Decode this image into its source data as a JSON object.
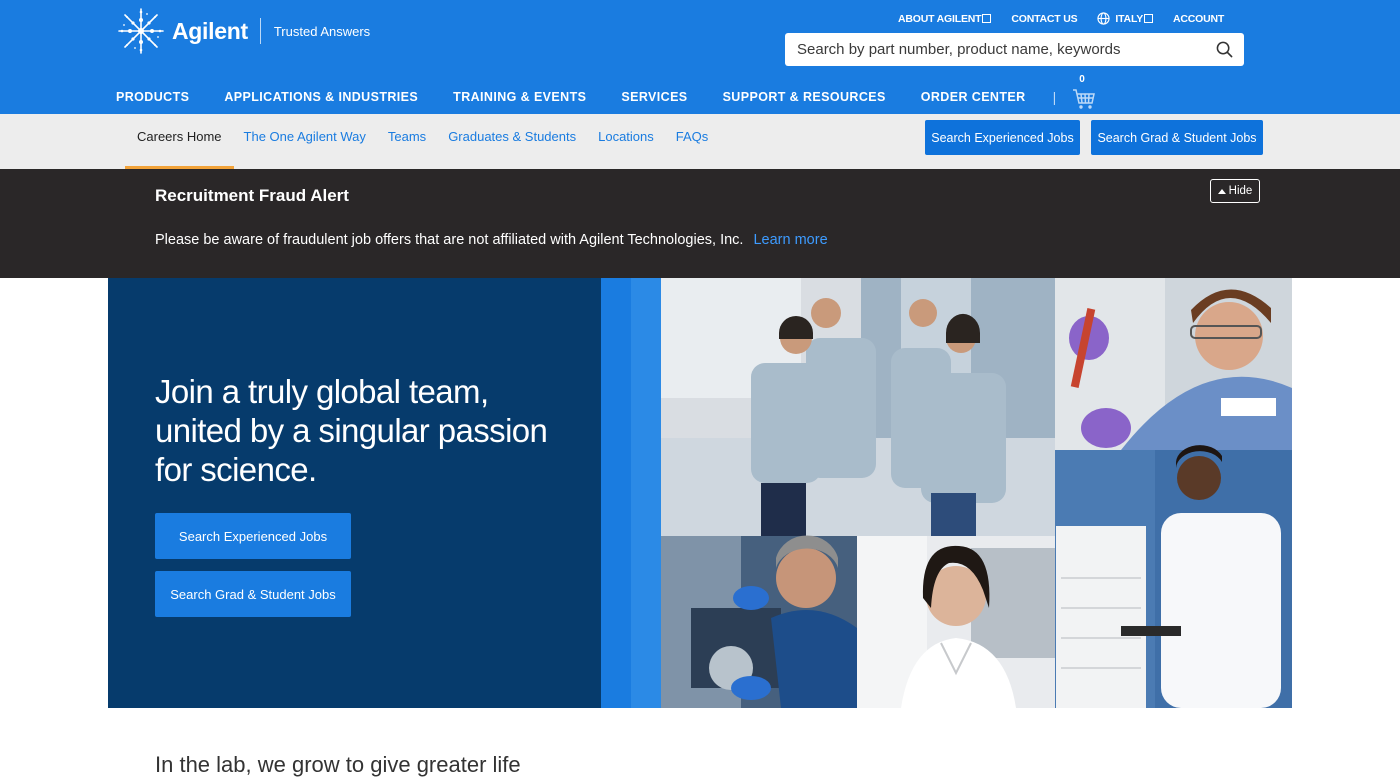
{
  "brand": {
    "name": "Agilent",
    "tagline": "Trusted Answers"
  },
  "utility_nav": [
    {
      "label": "ABOUT AGILENT",
      "icon": "external-link-icon"
    },
    {
      "label": "CONTACT US"
    },
    {
      "label": "ITALY",
      "icon": "globe-icon"
    },
    {
      "label": "ACCOUNT"
    }
  ],
  "search": {
    "placeholder": "Search by part number, product name, keywords",
    "icon": "search-icon"
  },
  "main_nav": [
    "PRODUCTS",
    "APPLICATIONS & INDUSTRIES",
    "TRAINING & EVENTS",
    "SERVICES",
    "SUPPORT & RESOURCES",
    "ORDER CENTER"
  ],
  "cart": {
    "count": "0",
    "icon": "shopping-cart-icon"
  },
  "sub_nav": {
    "items": [
      "Careers Home",
      "The One Agilent Way",
      "Teams",
      "Graduates & Students",
      "Locations",
      "FAQs"
    ],
    "active": "Careers Home",
    "buttons": [
      "Search Experienced Jobs",
      "Search Grad & Student Jobs"
    ]
  },
  "alert": {
    "title": "Recruitment Fraud Alert",
    "text": "Please be aware of fraudulent job offers that are not affiliated with Agilent Technologies, Inc.",
    "link": "Learn more",
    "hide_label": "Hide"
  },
  "hero": {
    "headline": "Join a truly global team, united by a singular passion for science.",
    "buttons": [
      "Search Experienced Jobs",
      "Search Grad & Student Jobs"
    ]
  },
  "teaser": "In the lab, we grow to give greater life",
  "colors": {
    "brand_blue": "#1a7ce0",
    "hero_navy": "#063b6c",
    "alert_bg": "#2a2728",
    "accent_orange": "#f2a33a"
  }
}
